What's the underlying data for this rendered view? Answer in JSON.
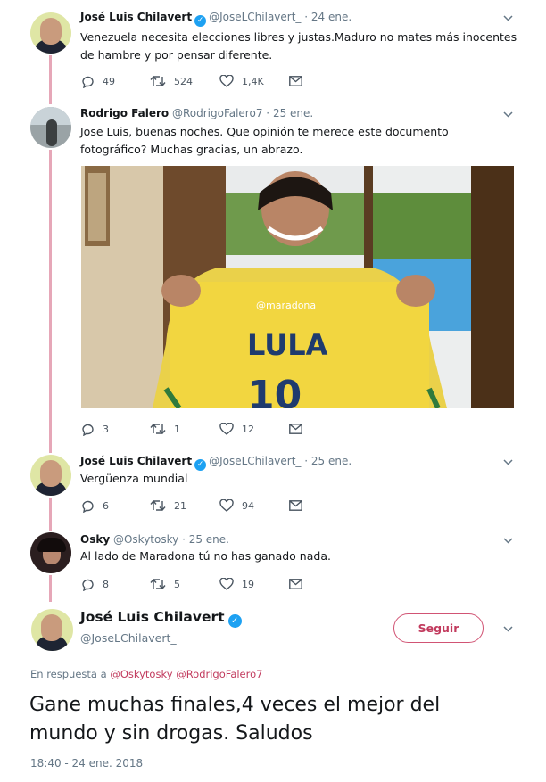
{
  "tweets": [
    {
      "name": "José Luis Chilavert",
      "verified": true,
      "handle": "@JoseLChilavert_",
      "date": "24 ene.",
      "text": "Venezuela necesita elecciones libres y justas.Maduro no mates más inocentes de hambre y por pensar diferente.",
      "replies": "49",
      "retweets": "524",
      "likes": "1,4K",
      "avatar": "chilavert-avatar"
    },
    {
      "name": "Rodrigo Falero",
      "verified": false,
      "handle": "@RodrigoFalero7",
      "date": "25 ene.",
      "text": "Jose Luis, buenas noches. Que opinión te merece este documento fotográfico? Muchas gracias, un abrazo.",
      "replies": "3",
      "retweets": "1",
      "likes": "12",
      "avatar": "rodrigo-avatar",
      "photo": {
        "watermark": "@maradona",
        "shirt_text": "LULA",
        "shirt_number": "10"
      }
    },
    {
      "name": "José Luis Chilavert",
      "verified": true,
      "handle": "@JoseLChilavert_",
      "date": "25 ene.",
      "text": "Vergüenza mundial",
      "replies": "6",
      "retweets": "21",
      "likes": "94",
      "avatar": "chilavert-avatar"
    },
    {
      "name": "Osky",
      "verified": false,
      "handle": "@Oskytosky",
      "date": "25 ene.",
      "text": "Al lado de Maradona tú no has ganado nada.",
      "replies": "8",
      "retweets": "5",
      "likes": "19",
      "avatar": "osky-avatar"
    }
  ],
  "main_tweet": {
    "name": "José Luis Chilavert",
    "verified": true,
    "handle": "@JoseLChilavert_",
    "follow_label": "Seguir",
    "reply_prefix": "En respuesta a",
    "reply_mentions": [
      "@Oskytosky",
      "@RodrigoFalero7"
    ],
    "text": "Gane muchas finales,4 veces el mejor del mundo y sin drogas. Saludos",
    "timestamp": "18:40 - 24 ene. 2018"
  },
  "separator": "·",
  "icons": {
    "reply": "reply-icon",
    "retweet": "retweet-icon",
    "like": "heart-icon",
    "dm": "envelope-icon",
    "menu": "chevron-down-icon",
    "verified": "verified-badge-icon"
  },
  "colors": {
    "accent": "#c23b5e",
    "thread_line": "#e6a7b8",
    "verified": "#1da1f2",
    "muted": "#657786"
  }
}
